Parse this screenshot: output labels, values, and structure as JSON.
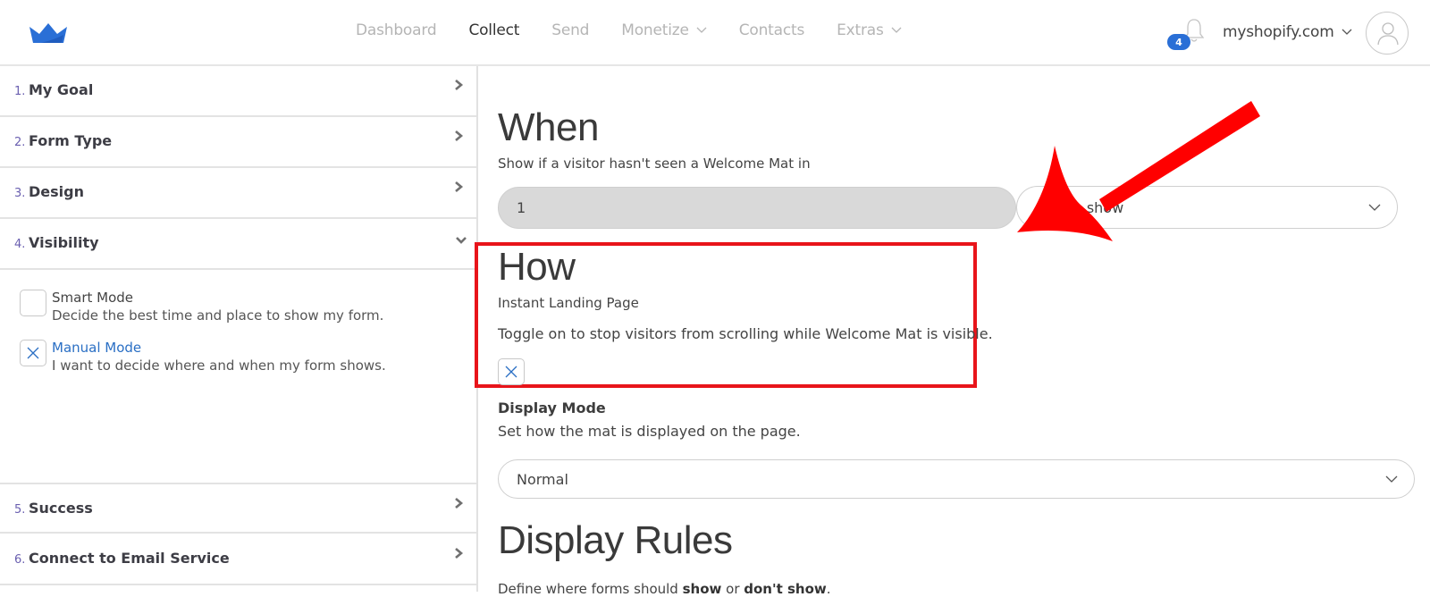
{
  "header": {
    "logo": "crown-icon",
    "nav": [
      {
        "label": "Dashboard",
        "active": false,
        "has_dropdown": false
      },
      {
        "label": "Collect",
        "active": true,
        "has_dropdown": false
      },
      {
        "label": "Send",
        "active": false,
        "has_dropdown": false
      },
      {
        "label": "Monetize",
        "active": false,
        "has_dropdown": true
      },
      {
        "label": "Contacts",
        "active": false,
        "has_dropdown": false
      },
      {
        "label": "Extras",
        "active": false,
        "has_dropdown": true
      }
    ],
    "notifications_count": "4",
    "account_label": "myshopify.com"
  },
  "sidebar": {
    "steps": [
      {
        "num": "1.",
        "label": "My Goal",
        "expanded": false
      },
      {
        "num": "2.",
        "label": "Form Type",
        "expanded": false
      },
      {
        "num": "3.",
        "label": "Design",
        "expanded": false
      },
      {
        "num": "4.",
        "label": "Visibility",
        "expanded": true
      },
      {
        "num": "5.",
        "label": "Success",
        "expanded": false
      },
      {
        "num": "6.",
        "label": "Connect to Email Service",
        "expanded": false
      }
    ],
    "modes": [
      {
        "title": "Smart Mode",
        "description": "Decide the best time and place to show my form.",
        "checked": false
      },
      {
        "title": "Manual Mode",
        "description": "I want to decide where and when my form shows.",
        "checked": true
      }
    ]
  },
  "main": {
    "when": {
      "heading": "When",
      "subtitle": "Show if a visitor hasn't seen a Welcome Mat in",
      "count_value": "1",
      "unit_select_value": "after a show"
    },
    "how": {
      "heading": "How",
      "subtitle": "Instant Landing Page",
      "toggle_description": "Toggle on to stop visitors from scrolling while Welcome Mat is visible.",
      "toggle_checked": true
    },
    "display_mode": {
      "label": "Display Mode",
      "description": "Set how the mat is displayed on the page.",
      "select_value": "Normal"
    },
    "display_rules": {
      "heading": "Display Rules",
      "text_prefix": "Define where forms should ",
      "text_show": "show",
      "text_or": " or ",
      "text_dont_show": "don't show",
      "text_suffix": "."
    }
  },
  "annotations": {
    "highlight_color": "#e8141a",
    "arrow_color": "#ff0000"
  },
  "colors": {
    "brand_blue": "#2a6fd6",
    "step_number": "#6a5fb0",
    "selected_mode": "#2a6fc4"
  }
}
